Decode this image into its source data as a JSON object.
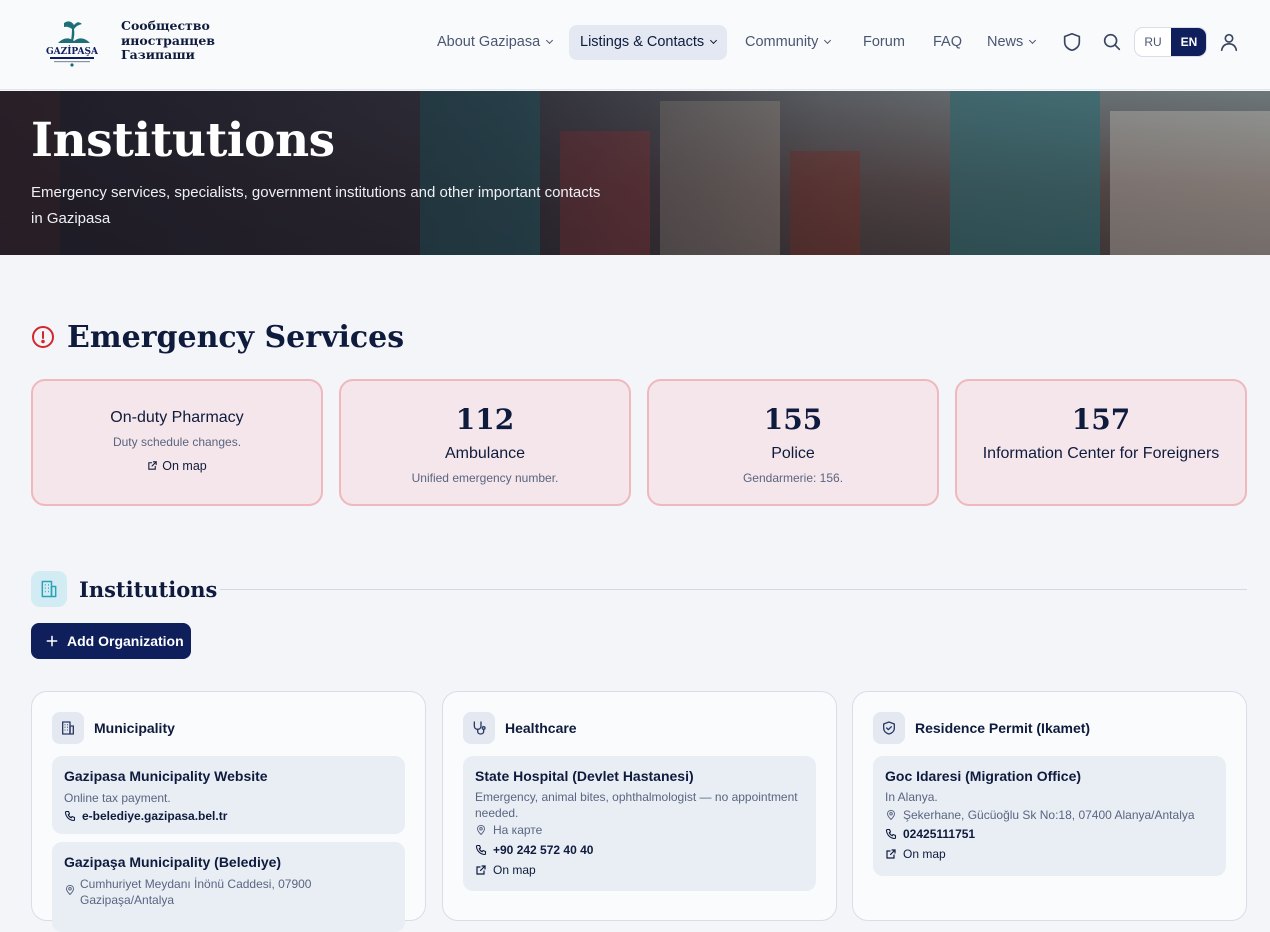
{
  "brand": {
    "line1": "Сообщество",
    "line2": "иностранцев",
    "line3": "Газипаши"
  },
  "nav": {
    "items": [
      {
        "label": "About Gazipasa",
        "dropdown": true
      },
      {
        "label": "Listings & Contacts",
        "dropdown": true,
        "active": true
      },
      {
        "label": "Community",
        "dropdown": true
      },
      {
        "label": "Forum",
        "dropdown": false
      },
      {
        "label": "FAQ",
        "dropdown": false
      },
      {
        "label": "News",
        "dropdown": true
      }
    ],
    "lang_ru": "RU",
    "lang_en": "EN",
    "icons": [
      "shield-icon",
      "search-icon",
      "user-icon"
    ]
  },
  "hero": {
    "title": "Institutions",
    "subtitle": "Emergency services, specialists, government institutions and other important contacts in Gazipasa"
  },
  "emergency": {
    "title": "Emergency Services",
    "cards": [
      {
        "title": "On-duty Pharmacy",
        "subtitle": "Duty schedule changes.",
        "link": "On map"
      },
      {
        "number": "112",
        "title": "Ambulance",
        "subtitle": "Unified emergency number."
      },
      {
        "number": "155",
        "title": "Police",
        "subtitle": "Gendarmerie: 156."
      },
      {
        "number": "157",
        "title": "Information Center for Foreigners"
      }
    ]
  },
  "institutions": {
    "title": "Institutions",
    "add_label": "Add Organization",
    "columns": [
      {
        "title": "Municipality",
        "entries": [
          {
            "title": "Gazipasa Municipality Website",
            "desc": "Online tax payment.",
            "phone": "e-belediye.gazipasa.bel.tr"
          },
          {
            "title": "Gazipaşa Municipality (Belediye)",
            "address": "Cumhuriyet Meydanı İnönü Caddesi, 07900 Gazipaşa/Antalya"
          }
        ]
      },
      {
        "title": "Healthcare",
        "entries": [
          {
            "title": "State Hospital (Devlet Hastanesi)",
            "desc": "Emergency, animal bites, ophthalmologist — no appointment needed.",
            "address": "На карте",
            "phone": "+90 242 572 40 40",
            "link": "On map"
          }
        ]
      },
      {
        "title": "Residence Permit (Ikamet)",
        "entries": [
          {
            "title": "Goc Idaresi (Migration Office)",
            "desc": "In Alanya.",
            "address": "Şekerhane, Gücüoğlu Sk No:18, 07400 Alanya/Antalya",
            "phone": "02425111751",
            "link": "On map"
          }
        ]
      }
    ]
  },
  "colors": {
    "navy": "#0f1f5c",
    "emergency_bg": "#f4e6ea",
    "emergency_border": "#efb8bd",
    "alert_red": "#d4262e",
    "accent_teal": "#2aa3b8"
  }
}
